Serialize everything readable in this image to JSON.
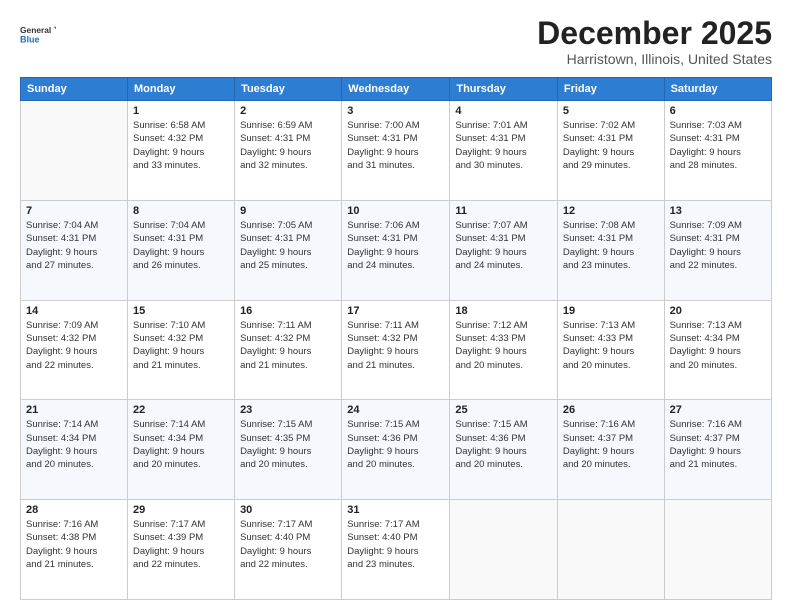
{
  "header": {
    "logo": {
      "line1": "General",
      "line2": "Blue"
    },
    "month": "December 2025",
    "location": "Harristown, Illinois, United States"
  },
  "weekdays": [
    "Sunday",
    "Monday",
    "Tuesday",
    "Wednesday",
    "Thursday",
    "Friday",
    "Saturday"
  ],
  "weeks": [
    [
      {
        "day": "",
        "info": ""
      },
      {
        "day": "1",
        "info": "Sunrise: 6:58 AM\nSunset: 4:32 PM\nDaylight: 9 hours\nand 33 minutes."
      },
      {
        "day": "2",
        "info": "Sunrise: 6:59 AM\nSunset: 4:31 PM\nDaylight: 9 hours\nand 32 minutes."
      },
      {
        "day": "3",
        "info": "Sunrise: 7:00 AM\nSunset: 4:31 PM\nDaylight: 9 hours\nand 31 minutes."
      },
      {
        "day": "4",
        "info": "Sunrise: 7:01 AM\nSunset: 4:31 PM\nDaylight: 9 hours\nand 30 minutes."
      },
      {
        "day": "5",
        "info": "Sunrise: 7:02 AM\nSunset: 4:31 PM\nDaylight: 9 hours\nand 29 minutes."
      },
      {
        "day": "6",
        "info": "Sunrise: 7:03 AM\nSunset: 4:31 PM\nDaylight: 9 hours\nand 28 minutes."
      }
    ],
    [
      {
        "day": "7",
        "info": "Sunrise: 7:04 AM\nSunset: 4:31 PM\nDaylight: 9 hours\nand 27 minutes."
      },
      {
        "day": "8",
        "info": "Sunrise: 7:04 AM\nSunset: 4:31 PM\nDaylight: 9 hours\nand 26 minutes."
      },
      {
        "day": "9",
        "info": "Sunrise: 7:05 AM\nSunset: 4:31 PM\nDaylight: 9 hours\nand 25 minutes."
      },
      {
        "day": "10",
        "info": "Sunrise: 7:06 AM\nSunset: 4:31 PM\nDaylight: 9 hours\nand 24 minutes."
      },
      {
        "day": "11",
        "info": "Sunrise: 7:07 AM\nSunset: 4:31 PM\nDaylight: 9 hours\nand 24 minutes."
      },
      {
        "day": "12",
        "info": "Sunrise: 7:08 AM\nSunset: 4:31 PM\nDaylight: 9 hours\nand 23 minutes."
      },
      {
        "day": "13",
        "info": "Sunrise: 7:09 AM\nSunset: 4:31 PM\nDaylight: 9 hours\nand 22 minutes."
      }
    ],
    [
      {
        "day": "14",
        "info": "Sunrise: 7:09 AM\nSunset: 4:32 PM\nDaylight: 9 hours\nand 22 minutes."
      },
      {
        "day": "15",
        "info": "Sunrise: 7:10 AM\nSunset: 4:32 PM\nDaylight: 9 hours\nand 21 minutes."
      },
      {
        "day": "16",
        "info": "Sunrise: 7:11 AM\nSunset: 4:32 PM\nDaylight: 9 hours\nand 21 minutes."
      },
      {
        "day": "17",
        "info": "Sunrise: 7:11 AM\nSunset: 4:32 PM\nDaylight: 9 hours\nand 21 minutes."
      },
      {
        "day": "18",
        "info": "Sunrise: 7:12 AM\nSunset: 4:33 PM\nDaylight: 9 hours\nand 20 minutes."
      },
      {
        "day": "19",
        "info": "Sunrise: 7:13 AM\nSunset: 4:33 PM\nDaylight: 9 hours\nand 20 minutes."
      },
      {
        "day": "20",
        "info": "Sunrise: 7:13 AM\nSunset: 4:34 PM\nDaylight: 9 hours\nand 20 minutes."
      }
    ],
    [
      {
        "day": "21",
        "info": "Sunrise: 7:14 AM\nSunset: 4:34 PM\nDaylight: 9 hours\nand 20 minutes."
      },
      {
        "day": "22",
        "info": "Sunrise: 7:14 AM\nSunset: 4:34 PM\nDaylight: 9 hours\nand 20 minutes."
      },
      {
        "day": "23",
        "info": "Sunrise: 7:15 AM\nSunset: 4:35 PM\nDaylight: 9 hours\nand 20 minutes."
      },
      {
        "day": "24",
        "info": "Sunrise: 7:15 AM\nSunset: 4:36 PM\nDaylight: 9 hours\nand 20 minutes."
      },
      {
        "day": "25",
        "info": "Sunrise: 7:15 AM\nSunset: 4:36 PM\nDaylight: 9 hours\nand 20 minutes."
      },
      {
        "day": "26",
        "info": "Sunrise: 7:16 AM\nSunset: 4:37 PM\nDaylight: 9 hours\nand 20 minutes."
      },
      {
        "day": "27",
        "info": "Sunrise: 7:16 AM\nSunset: 4:37 PM\nDaylight: 9 hours\nand 21 minutes."
      }
    ],
    [
      {
        "day": "28",
        "info": "Sunrise: 7:16 AM\nSunset: 4:38 PM\nDaylight: 9 hours\nand 21 minutes."
      },
      {
        "day": "29",
        "info": "Sunrise: 7:17 AM\nSunset: 4:39 PM\nDaylight: 9 hours\nand 22 minutes."
      },
      {
        "day": "30",
        "info": "Sunrise: 7:17 AM\nSunset: 4:40 PM\nDaylight: 9 hours\nand 22 minutes."
      },
      {
        "day": "31",
        "info": "Sunrise: 7:17 AM\nSunset: 4:40 PM\nDaylight: 9 hours\nand 23 minutes."
      },
      {
        "day": "",
        "info": ""
      },
      {
        "day": "",
        "info": ""
      },
      {
        "day": "",
        "info": ""
      }
    ]
  ]
}
